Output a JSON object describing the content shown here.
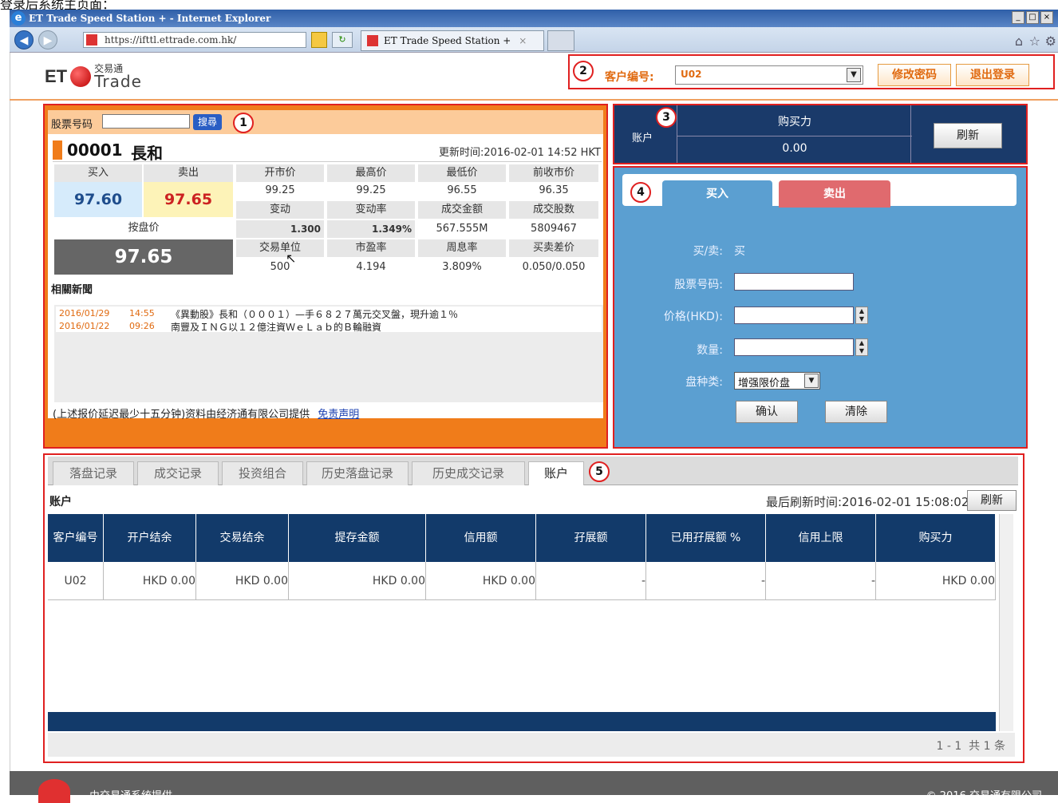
{
  "doc_caption": "登录后系统主页面：",
  "browser": {
    "title": "ET Trade Speed Station + - Internet Explorer",
    "url": "https://ifttl.ettrade.com.hk/",
    "tab_title": "ET Trade Speed Station +",
    "tab_close": "×"
  },
  "logo": {
    "et": "ET",
    "cn": "交易通",
    "trade": "Trade"
  },
  "header": {
    "customer_label": "客户编号:",
    "customer_value": "U02",
    "change_pwd": "修改密码",
    "logout": "退出登录"
  },
  "markers": [
    "1",
    "2",
    "3",
    "4",
    "5"
  ],
  "quote": {
    "search_label": "股票号码",
    "search_btn": "搜尋",
    "code": "00001",
    "name": "長和",
    "update_time": "更新时间:2016-02-01 14:52 HKT",
    "buy_label": "买入",
    "sell_label": "卖出",
    "buy": "97.60",
    "sell": "97.65",
    "nominal_label": "按盘价",
    "nominal": "97.65",
    "row1_labels": [
      "开市价",
      "最高价",
      "最低价",
      "前收市价"
    ],
    "row1_values": [
      "99.25",
      "99.25",
      "96.55",
      "96.35"
    ],
    "row2_labels": [
      "变动",
      "变动率",
      "成交金额",
      "成交股数"
    ],
    "row2_values": [
      "1.300",
      "1.349%",
      "567.555M",
      "5809467"
    ],
    "row3_labels": [
      "交易单位",
      "市盈率",
      "周息率",
      "买卖差价"
    ],
    "row3_values": [
      "500",
      "4.194",
      "3.809%",
      "0.050/0.050"
    ],
    "news_title": "相關新聞",
    "news": [
      {
        "date": "2016/01/29",
        "time": "14:55",
        "text": "《異動股》長和（０００１）—手６８２７萬元交叉盤，現升逾１％"
      },
      {
        "date": "2016/01/22",
        "time": "09:26",
        "text": "南豐及ＩＮＧ以１２億注資ＷｅＬａｂ的Ｂ輪融資"
      }
    ],
    "disclaimer": "(上述报价延迟最少十五分钟)资料由经济通有限公司提供",
    "disclaimer_link": "免责声明"
  },
  "account_box": {
    "label": "账户",
    "bp_label": "购买力",
    "bp_value": "0.00",
    "refresh": "刷新"
  },
  "order": {
    "tab_buy": "买入",
    "tab_sell": "卖出",
    "side_label": "买/卖:",
    "side_value": "买",
    "code_label": "股票号码:",
    "price_label": "价格(HKD):",
    "qty_label": "数量:",
    "type_label": "盘种类:",
    "type_value": "增强限价盘",
    "confirm": "确认",
    "clear": "清除"
  },
  "bottom": {
    "tabs": [
      "落盘记录",
      "成交记录",
      "投资组合",
      "历史落盘记录",
      "历史成交记录",
      "账户"
    ],
    "section_title": "账户",
    "last_refresh": "最后刷新时间:2016-02-01 15:08:02",
    "refresh": "刷新",
    "columns": [
      "客户编号",
      "开户结余",
      "交易结余",
      "提存金额",
      "信用额",
      "孖展额",
      "已用孖展额 %",
      "信用上限",
      "购买力"
    ],
    "rows": [
      [
        "U02",
        "HKD 0.00",
        "HKD 0.00",
        "HKD 0.00",
        "HKD 0.00",
        "-",
        "-",
        "-",
        "HKD 0.00"
      ]
    ],
    "pager": "1 - 1  共 1 条"
  },
  "footer": {
    "left": "由交易通系统提供",
    "right": "© 2016 交易通有限公司"
  },
  "colors": {
    "orange": "#f07c1a",
    "navy": "#123a6a",
    "blue": "#5b9fd1",
    "red": "#e02020"
  }
}
